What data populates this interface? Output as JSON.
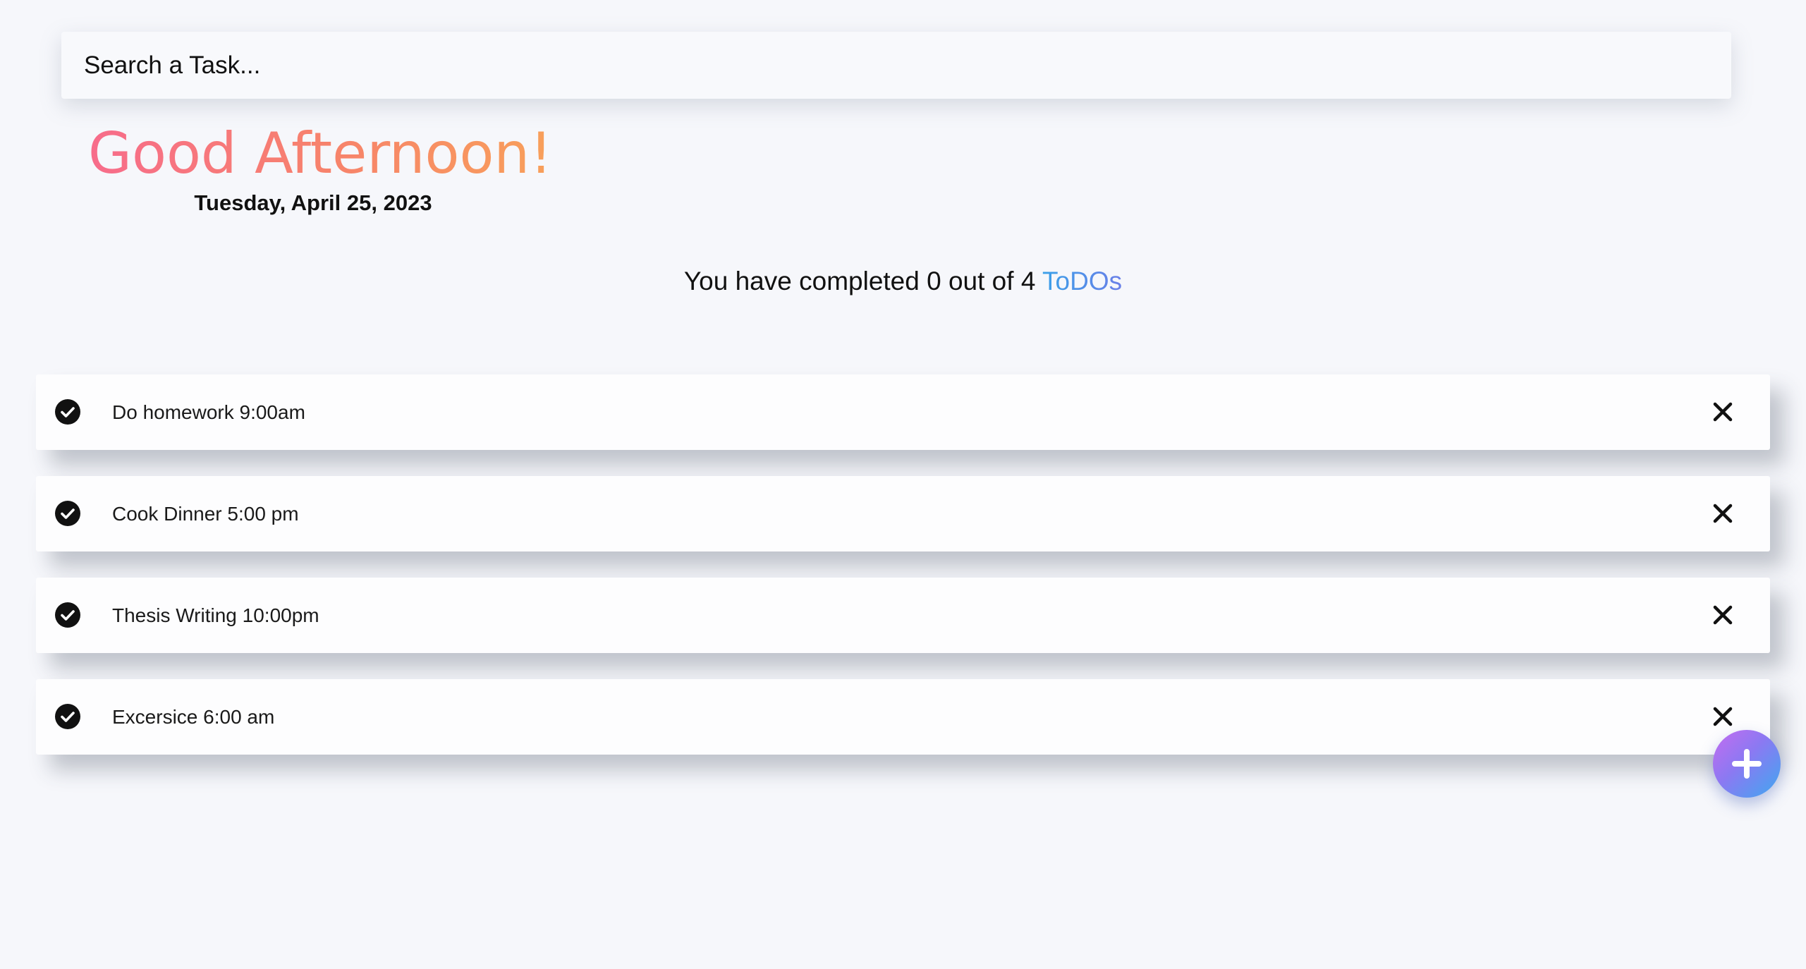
{
  "search": {
    "placeholder": "Search a Task..."
  },
  "greeting": {
    "title": "Good Afternoon!",
    "date": "Tuesday, April 25, 2023"
  },
  "summary": {
    "prefix": "You have completed 0 out of 4",
    "accent": "ToDOs",
    "completed": 0,
    "total": 4
  },
  "todos": [
    {
      "text": "Do homework 9:00am",
      "done": false
    },
    {
      "text": "Cook Dinner 5:00 pm",
      "done": false
    },
    {
      "text": "Thesis Writing 10:00pm",
      "done": false
    },
    {
      "text": "Excersice 6:00 am",
      "done": false
    }
  ],
  "icons": {
    "complete": "check-circle-icon",
    "delete": "close-icon",
    "add": "plus-icon"
  },
  "colors": {
    "background": "#f6f7fb",
    "greeting_gradient": [
      "#f76c8b",
      "#f8a05a"
    ],
    "accent_gradient": [
      "#3aa0e8",
      "#6a7fe8"
    ],
    "fab_gradient": [
      "#c56cf0",
      "#3fa8f0"
    ]
  }
}
